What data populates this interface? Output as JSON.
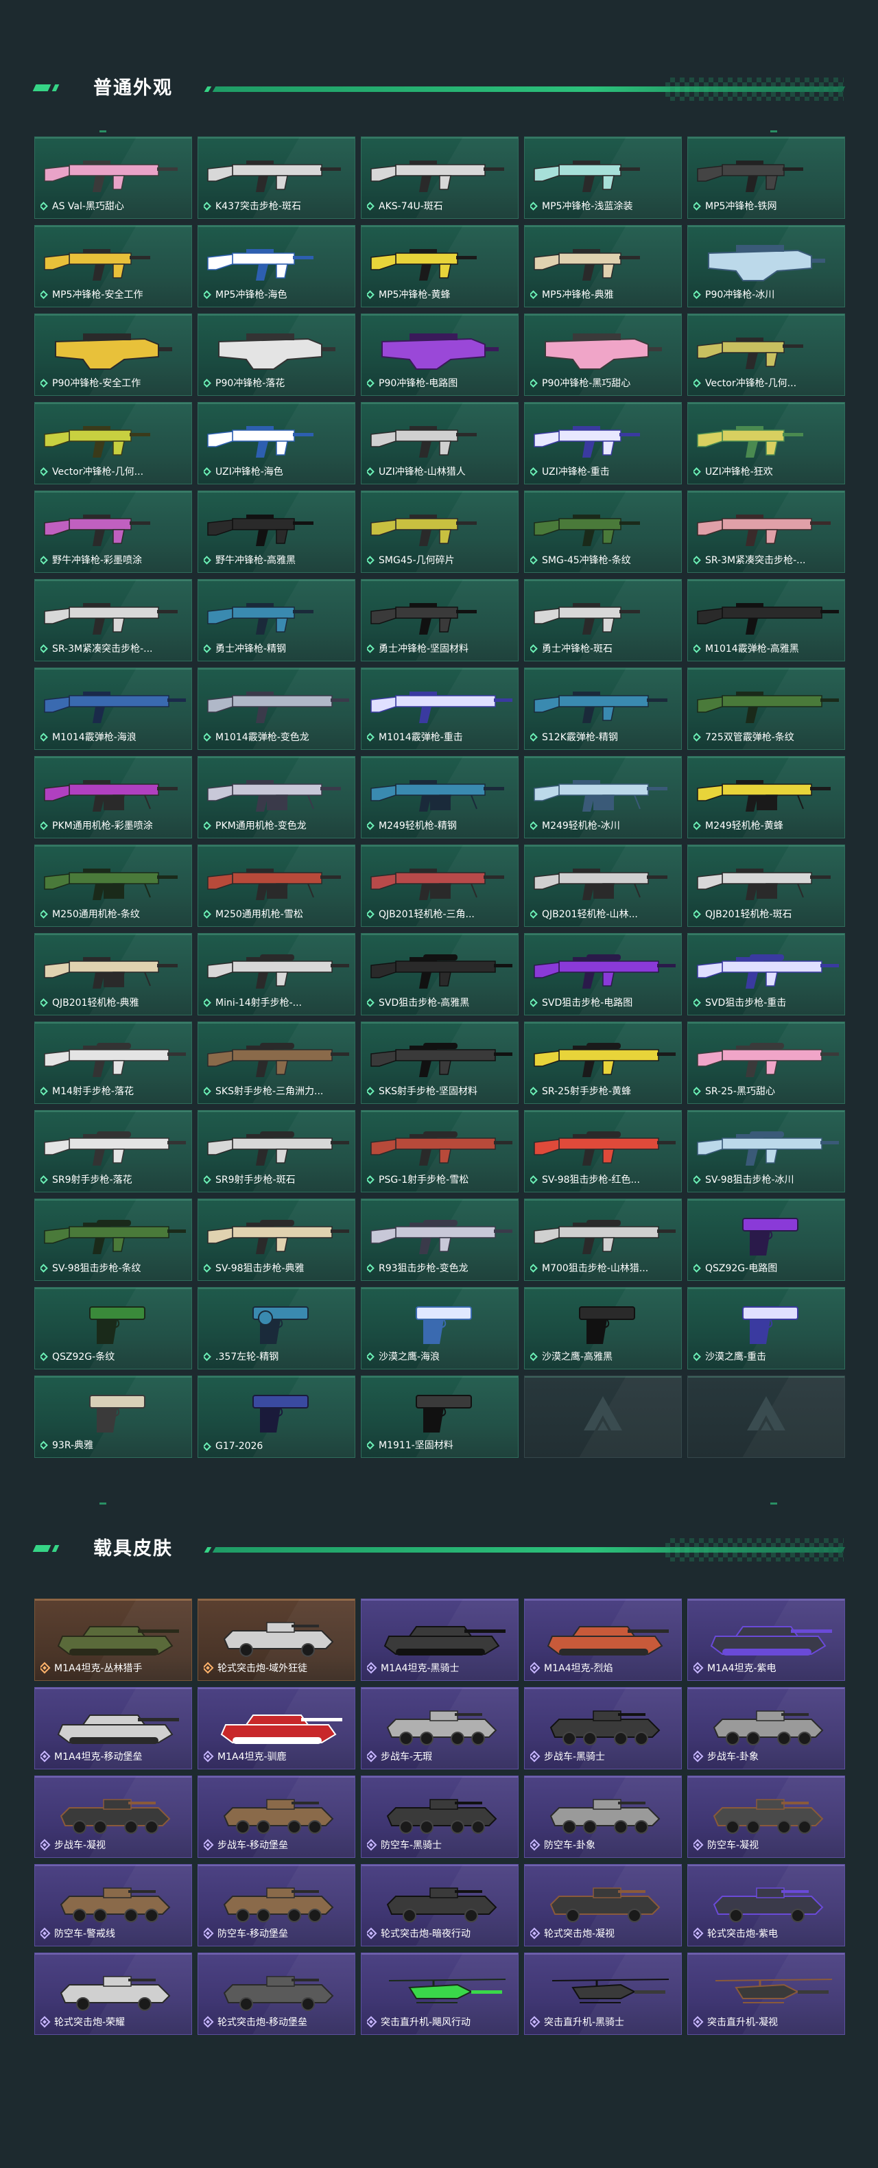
{
  "sections": {
    "weapons_title": "普通外观",
    "vehicles_title": "载具皮肤"
  },
  "colors": {
    "background": "#1d2a2f",
    "accent_green": "#36d486",
    "weapon_card": "#1f5a4b",
    "vehicle_card_purple": "#4c4283",
    "vehicle_card_orange": "#5b4030"
  },
  "weapons": [
    {
      "name": "AS Val-黑巧甜心",
      "kind": "rifle",
      "colors": [
        "#e9a3c8",
        "#3a3a3a"
      ]
    },
    {
      "name": "K437突击步枪-斑石",
      "kind": "rifle",
      "colors": [
        "#d8d8d8",
        "#2a2a2a"
      ]
    },
    {
      "name": "AKS-74U-斑石",
      "kind": "rifle",
      "colors": [
        "#d8d8d8",
        "#2a2a2a"
      ]
    },
    {
      "name": "MP5冲锋枪-浅蓝涂装",
      "kind": "smg",
      "colors": [
        "#a7e0d9",
        "#2a2a2a"
      ]
    },
    {
      "name": "MP5冲锋枪-铁网",
      "kind": "smg",
      "colors": [
        "#444444",
        "#222222"
      ]
    },
    {
      "name": "MP5冲锋枪-安全工作",
      "kind": "smg",
      "colors": [
        "#e8c13a",
        "#2a2a2a"
      ]
    },
    {
      "name": "MP5冲锋枪-海色",
      "kind": "smg",
      "colors": [
        "#ffffff",
        "#2d5fb0"
      ]
    },
    {
      "name": "MP5冲锋枪-黄蜂",
      "kind": "smg",
      "colors": [
        "#e8d43a",
        "#1a1a1a"
      ]
    },
    {
      "name": "MP5冲锋枪-典雅",
      "kind": "smg",
      "colors": [
        "#e0d2b0",
        "#2a2a2a"
      ]
    },
    {
      "name": "P90冲锋枪-冰川",
      "kind": "p90",
      "colors": [
        "#bcd9ea",
        "#3a5a78"
      ]
    },
    {
      "name": "P90冲锋枪-安全工作",
      "kind": "p90",
      "colors": [
        "#e8c13a",
        "#2a2a2a"
      ]
    },
    {
      "name": "P90冲锋枪-落花",
      "kind": "p90",
      "colors": [
        "#e4e4e4",
        "#333333"
      ]
    },
    {
      "name": "P90冲锋枪-电路图",
      "kind": "p90",
      "colors": [
        "#9a48d8",
        "#3a1a5a"
      ]
    },
    {
      "name": "P90冲锋枪-黑巧甜心",
      "kind": "p90",
      "colors": [
        "#f0a5c8",
        "#3a3a3a"
      ]
    },
    {
      "name": "Vector冲锋枪-几何...",
      "kind": "smg",
      "colors": [
        "#c8c060",
        "#2a2a2a"
      ]
    },
    {
      "name": "Vector冲锋枪-几何...",
      "kind": "smg",
      "colors": [
        "#c8d040",
        "#3a3a1a"
      ]
    },
    {
      "name": "UZI冲锋枪-海色",
      "kind": "smg",
      "colors": [
        "#ffffff",
        "#2d5fb0"
      ]
    },
    {
      "name": "UZI冲锋枪-山林猎人",
      "kind": "smg",
      "colors": [
        "#d0d0d0",
        "#2a2a2a"
      ]
    },
    {
      "name": "UZI冲锋枪-重击",
      "kind": "smg",
      "colors": [
        "#e8e8ff",
        "#3a3aa0"
      ]
    },
    {
      "name": "UZI冲锋枪-狂欢",
      "kind": "smg",
      "colors": [
        "#d8d060",
        "#4a8a50"
      ]
    },
    {
      "name": "野牛冲锋枪-彩墨喷涂",
      "kind": "smg",
      "colors": [
        "#c060c0",
        "#2a2a2a"
      ]
    },
    {
      "name": "野牛冲锋枪-高雅黑",
      "kind": "smg",
      "colors": [
        "#2a2a2a",
        "#111111"
      ]
    },
    {
      "name": "SMG45-几何碎片",
      "kind": "smg",
      "colors": [
        "#c8c040",
        "#2a2a2a"
      ]
    },
    {
      "name": "SMG-45冲锋枪-条纹",
      "kind": "smg",
      "colors": [
        "#4a7a3a",
        "#1a2a1a"
      ]
    },
    {
      "name": "SR-3M紧凑突击步枪-...",
      "kind": "rifle",
      "colors": [
        "#e0a0a8",
        "#3a2a2a"
      ]
    },
    {
      "name": "SR-3M紧凑突击步枪-...",
      "kind": "rifle",
      "colors": [
        "#d8d8d8",
        "#2a2a2a"
      ]
    },
    {
      "name": "勇士冲锋枪-精钢",
      "kind": "smg",
      "colors": [
        "#3a8ab0",
        "#1a2a3a"
      ]
    },
    {
      "name": "勇士冲锋枪-坚固材料",
      "kind": "smg",
      "colors": [
        "#3a3a3a",
        "#111111"
      ]
    },
    {
      "name": "勇士冲锋枪-斑石",
      "kind": "smg",
      "colors": [
        "#d8d8d8",
        "#2a2a2a"
      ]
    },
    {
      "name": "M1014霰弹枪-高雅黑",
      "kind": "shotgun",
      "colors": [
        "#2a2a2a",
        "#111111"
      ]
    },
    {
      "name": "M1014霰弹枪-海浪",
      "kind": "shotgun",
      "colors": [
        "#3a6ab0",
        "#1a2a4a"
      ]
    },
    {
      "name": "M1014霰弹枪-变色龙",
      "kind": "shotgun",
      "colors": [
        "#b0b8c8",
        "#3a3a4a"
      ]
    },
    {
      "name": "M1014霰弹枪-重击",
      "kind": "shotgun",
      "colors": [
        "#e0e0ff",
        "#3a3aa0"
      ]
    },
    {
      "name": "S12K霰弹枪-精钢",
      "kind": "rifle",
      "colors": [
        "#3a8ab0",
        "#1a2a3a"
      ]
    },
    {
      "name": "725双管霰弹枪-条纹",
      "kind": "shotgun",
      "colors": [
        "#4a7a3a",
        "#1a2a1a"
      ]
    },
    {
      "name": "PKM通用机枪-彩墨喷涂",
      "kind": "mg",
      "colors": [
        "#b040c0",
        "#2a2a2a"
      ]
    },
    {
      "name": "PKM通用机枪-变色龙",
      "kind": "mg",
      "colors": [
        "#c8c8d8",
        "#3a3a4a"
      ]
    },
    {
      "name": "M249轻机枪-精钢",
      "kind": "mg",
      "colors": [
        "#3a8ab0",
        "#1a2a3a"
      ]
    },
    {
      "name": "M249轻机枪-冰川",
      "kind": "mg",
      "colors": [
        "#bcd9ea",
        "#3a5a78"
      ]
    },
    {
      "name": "M249轻机枪-黄蜂",
      "kind": "mg",
      "colors": [
        "#e8d43a",
        "#1a1a1a"
      ]
    },
    {
      "name": "M250通用机枪-条纹",
      "kind": "mg",
      "colors": [
        "#4a7a3a",
        "#1a2a1a"
      ]
    },
    {
      "name": "M250通用机枪-雪松",
      "kind": "mg",
      "colors": [
        "#b84a3a",
        "#2a2a2a"
      ]
    },
    {
      "name": "QJB201轻机枪-三角...",
      "kind": "mg",
      "colors": [
        "#b84a4a",
        "#2a2a2a"
      ]
    },
    {
      "name": "QJB201轻机枪-山林...",
      "kind": "mg",
      "colors": [
        "#d0d0d0",
        "#2a2a2a"
      ]
    },
    {
      "name": "QJB201轻机枪-斑石",
      "kind": "mg",
      "colors": [
        "#d8d8d8",
        "#2a2a2a"
      ]
    },
    {
      "name": "QJB201轻机枪-典雅",
      "kind": "mg",
      "colors": [
        "#e0d2b0",
        "#2a2a2a"
      ]
    },
    {
      "name": "Mini-14射手步枪-...",
      "kind": "sniper",
      "colors": [
        "#d8d8d8",
        "#2a2a2a"
      ]
    },
    {
      "name": "SVD狙击步枪-高雅黑",
      "kind": "sniper",
      "colors": [
        "#2a2a2a",
        "#111111"
      ]
    },
    {
      "name": "SVD狙击步枪-电路图",
      "kind": "sniper",
      "colors": [
        "#8a3ad8",
        "#2a1a4a"
      ]
    },
    {
      "name": "SVD狙击步枪-重击",
      "kind": "sniper",
      "colors": [
        "#e0e0ff",
        "#3a3aa0"
      ]
    },
    {
      "name": "M14射手步枪-落花",
      "kind": "sniper",
      "colors": [
        "#e4e4e4",
        "#333333"
      ]
    },
    {
      "name": "SKS射手步枪-三角洲力...",
      "kind": "sniper",
      "colors": [
        "#8a6a4a",
        "#2a2a2a"
      ]
    },
    {
      "name": "SKS射手步枪-坚固材料",
      "kind": "sniper",
      "colors": [
        "#3a3a3a",
        "#111111"
      ]
    },
    {
      "name": "SR-25射手步枪-黄蜂",
      "kind": "sniper",
      "colors": [
        "#e8d43a",
        "#1a1a1a"
      ]
    },
    {
      "name": "SR-25-黑巧甜心",
      "kind": "sniper",
      "colors": [
        "#f0a5c8",
        "#3a3a3a"
      ]
    },
    {
      "name": "SR9射手步枪-落花",
      "kind": "sniper",
      "colors": [
        "#e4e4e4",
        "#333333"
      ]
    },
    {
      "name": "SR9射手步枪-斑石",
      "kind": "sniper",
      "colors": [
        "#d8d8d8",
        "#2a2a2a"
      ]
    },
    {
      "name": "PSG-1射手步枪-雪松",
      "kind": "sniper",
      "colors": [
        "#b84a3a",
        "#2a2a2a"
      ]
    },
    {
      "name": "SV-98狙击步枪-红色...",
      "kind": "sniper",
      "colors": [
        "#e04a3a",
        "#2a2a2a"
      ]
    },
    {
      "name": "SV-98狙击步枪-冰川",
      "kind": "sniper",
      "colors": [
        "#bcd9ea",
        "#3a5a78"
      ]
    },
    {
      "name": "SV-98狙击步枪-条纹",
      "kind": "sniper",
      "colors": [
        "#4a7a3a",
        "#1a2a1a"
      ]
    },
    {
      "name": "SV-98狙击步枪-典雅",
      "kind": "sniper",
      "colors": [
        "#e0d2b0",
        "#2a2a2a"
      ]
    },
    {
      "name": "R93狙击步枪-变色龙",
      "kind": "sniper",
      "colors": [
        "#c8c8d8",
        "#3a3a4a"
      ]
    },
    {
      "name": "M700狙击步枪-山林猎...",
      "kind": "sniper",
      "colors": [
        "#d0d0d0",
        "#2a2a2a"
      ]
    },
    {
      "name": "QSZ92G-电路图",
      "kind": "pistol",
      "colors": [
        "#8a3ad8",
        "#2a1a4a"
      ]
    },
    {
      "name": "QSZ92G-条纹",
      "kind": "pistol",
      "colors": [
        "#3a8a3a",
        "#1a2a1a"
      ]
    },
    {
      "name": ".357左轮-精钢",
      "kind": "revolver",
      "colors": [
        "#3a8ab0",
        "#1a2a3a"
      ]
    },
    {
      "name": "沙漠之鹰-海浪",
      "kind": "pistol",
      "colors": [
        "#e0e8ff",
        "#3a6ab0"
      ]
    },
    {
      "name": "沙漠之鹰-高雅黑",
      "kind": "pistol",
      "colors": [
        "#2a2a2a",
        "#111111"
      ]
    },
    {
      "name": "沙漠之鹰-重击",
      "kind": "pistol",
      "colors": [
        "#e0e0ff",
        "#3a3aa0"
      ]
    },
    {
      "name": "93R-典雅",
      "kind": "pistol",
      "colors": [
        "#d8d0b8",
        "#3a3a3a"
      ]
    },
    {
      "name": "G17-2026",
      "kind": "pistol",
      "colors": [
        "#3a4aa0",
        "#1a1a3a"
      ]
    },
    {
      "name": "M1911-坚固材料",
      "kind": "pistol",
      "colors": [
        "#3a3a3a",
        "#111111"
      ]
    },
    {
      "name": "",
      "kind": "empty",
      "colors": []
    },
    {
      "name": "",
      "kind": "empty",
      "colors": []
    }
  ],
  "vehicles": [
    {
      "name": "M1A4坦克-丛林猎手",
      "kind": "tank",
      "rarity": "orange",
      "colors": [
        "#5a6a3a",
        "#2a2a1a"
      ]
    },
    {
      "name": "轮式突击炮-域外狂徒",
      "kind": "wheeled",
      "rarity": "orange",
      "colors": [
        "#d0d0d0",
        "#2a2a2a"
      ]
    },
    {
      "name": "M1A4坦克-黑骑士",
      "kind": "tank",
      "rarity": "purple",
      "colors": [
        "#3a3a3a",
        "#111111"
      ]
    },
    {
      "name": "M1A4坦克-烈焰",
      "kind": "tank",
      "rarity": "purple",
      "colors": [
        "#c85a3a",
        "#2a2a2a"
      ]
    },
    {
      "name": "M1A4坦克-紫电",
      "kind": "tank",
      "rarity": "purple",
      "colors": [
        "#3a3a4a",
        "#6a4ad8"
      ]
    },
    {
      "name": "M1A4坦克-移动堡垒",
      "kind": "tank",
      "rarity": "purple",
      "colors": [
        "#d0d0d0",
        "#2a2a2a"
      ]
    },
    {
      "name": "M1A4坦克-驯鹿",
      "kind": "tank",
      "rarity": "purple",
      "colors": [
        "#c8282a",
        "#ffffff"
      ]
    },
    {
      "name": "步战车-无瑕",
      "kind": "apc",
      "rarity": "purple",
      "colors": [
        "#b0b0b0",
        "#2a2a2a"
      ]
    },
    {
      "name": "步战车-黑骑士",
      "kind": "apc",
      "rarity": "purple",
      "colors": [
        "#3a3a3a",
        "#111111"
      ]
    },
    {
      "name": "步战车-卦象",
      "kind": "apc",
      "rarity": "purple",
      "colors": [
        "#9a9a9a",
        "#2a2a2a"
      ]
    },
    {
      "name": "步战车-凝视",
      "kind": "apc",
      "rarity": "purple",
      "colors": [
        "#3a3a3a",
        "#8a5a3a"
      ]
    },
    {
      "name": "步战车-移动堡垒",
      "kind": "apc",
      "rarity": "purple",
      "colors": [
        "#8a6a4a",
        "#2a2a2a"
      ]
    },
    {
      "name": "防空车-黑骑士",
      "kind": "apc",
      "rarity": "purple",
      "colors": [
        "#3a3a3a",
        "#111111"
      ]
    },
    {
      "name": "防空车-卦象",
      "kind": "apc",
      "rarity": "purple",
      "colors": [
        "#9a9a9a",
        "#2a2a2a"
      ]
    },
    {
      "name": "防空车-凝视",
      "kind": "apc",
      "rarity": "purple",
      "colors": [
        "#4a4a4a",
        "#8a5a3a"
      ]
    },
    {
      "name": "防空车-警戒线",
      "kind": "apc",
      "rarity": "purple",
      "colors": [
        "#8a6a4a",
        "#2a2a2a"
      ]
    },
    {
      "name": "防空车-移动堡垒",
      "kind": "apc",
      "rarity": "purple",
      "colors": [
        "#8a6a4a",
        "#2a2a2a"
      ]
    },
    {
      "name": "轮式突击炮-暗夜行动",
      "kind": "wheeled",
      "rarity": "purple",
      "colors": [
        "#3a3a3a",
        "#111111"
      ]
    },
    {
      "name": "轮式突击炮-凝视",
      "kind": "wheeled",
      "rarity": "purple",
      "colors": [
        "#3a3a3a",
        "#8a5a3a"
      ]
    },
    {
      "name": "轮式突击炮-紫电",
      "kind": "wheeled",
      "rarity": "purple",
      "colors": [
        "#3a3a4a",
        "#6a4ad8"
      ]
    },
    {
      "name": "轮式突击炮-荣耀",
      "kind": "wheeled",
      "rarity": "purple",
      "colors": [
        "#d0d0d0",
        "#2a2a2a"
      ]
    },
    {
      "name": "轮式突击炮-移动堡垒",
      "kind": "wheeled",
      "rarity": "purple",
      "colors": [
        "#5a5a5a",
        "#2a2a2a"
      ]
    },
    {
      "name": "突击直升机-飓风行动",
      "kind": "heli",
      "rarity": "purple",
      "colors": [
        "#3ad84a",
        "#1a2a1a"
      ]
    },
    {
      "name": "突击直升机-黑骑士",
      "kind": "heli",
      "rarity": "purple",
      "colors": [
        "#3a3a3a",
        "#111111"
      ]
    },
    {
      "name": "突击直升机-凝视",
      "kind": "heli",
      "rarity": "purple",
      "colors": [
        "#3a3a3a",
        "#8a5a3a"
      ]
    }
  ]
}
